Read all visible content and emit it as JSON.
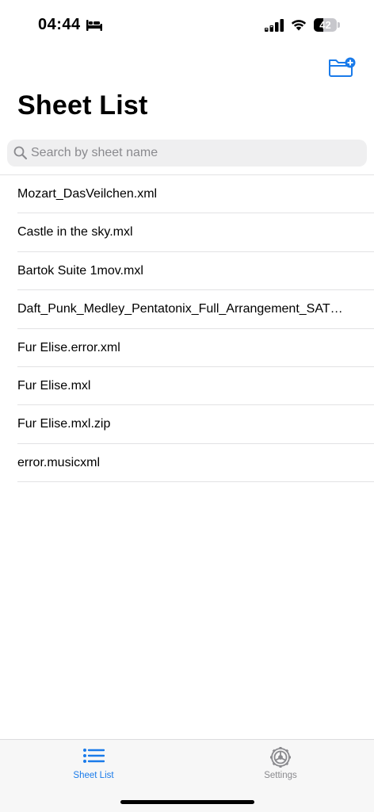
{
  "status_bar": {
    "time": "04:44",
    "battery": "42",
    "battery_level": 0.42,
    "icons": [
      "bed-icon",
      "cellular-signal-icon",
      "wifi-icon",
      "battery-icon"
    ]
  },
  "nav": {
    "add_button_icon": "folder-add-icon",
    "title": "Sheet List"
  },
  "search": {
    "placeholder": "Search by sheet name",
    "value": "",
    "icon": "magnifying-glass-icon"
  },
  "sheets": [
    "Mozart_DasVeilchen.xml",
    "Castle in the sky.mxl",
    "Bartok Suite 1mov.mxl",
    "Daft_Punk_Medley_Pentatonix_Full_Arrangement_SATB....",
    "Fur Elise.error.xml",
    "Fur Elise.mxl",
    "Fur Elise.mxl.zip",
    "error.musicxml"
  ],
  "tab_bar": {
    "tabs": [
      {
        "label": "Sheet List",
        "icon": "list-bullet-icon",
        "selected": true
      },
      {
        "label": "Settings",
        "icon": "gear-icon",
        "selected": false
      }
    ]
  },
  "colors": {
    "accent": "#1a7bea",
    "inactive": "#8a8a8e",
    "search_bg": "#efeff0",
    "separator": "#e2e2e4",
    "tab_bar_bg": "#f7f7f7"
  }
}
